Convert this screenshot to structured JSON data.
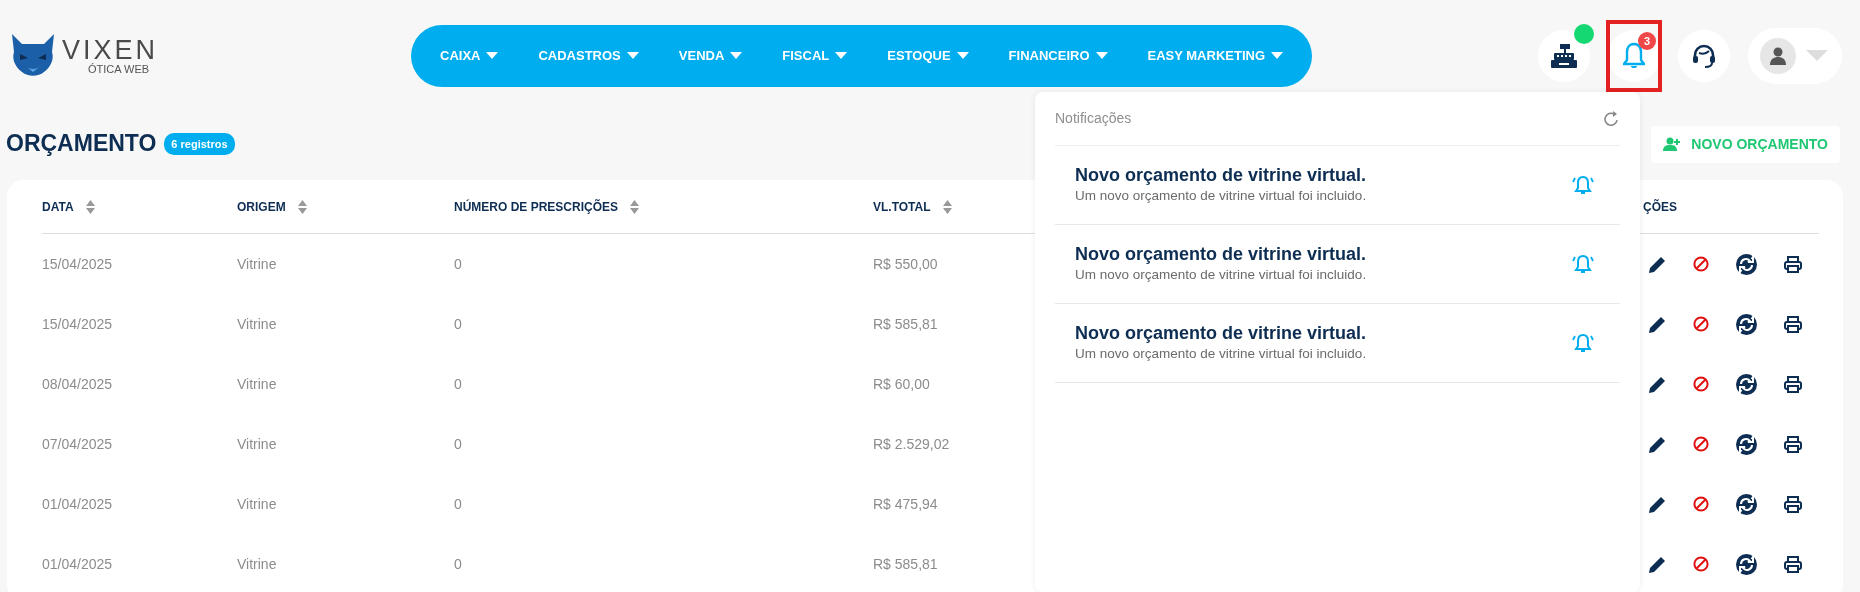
{
  "logo": {
    "name": "VIXEN",
    "tagline": "ÓTICA WEB"
  },
  "menu": [
    {
      "label": "CAIXA"
    },
    {
      "label": "CADASTROS"
    },
    {
      "label": "VENDA"
    },
    {
      "label": "FISCAL"
    },
    {
      "label": "ESTOQUE"
    },
    {
      "label": "FINANCEIRO"
    },
    {
      "label": "EASY MARKETING"
    }
  ],
  "cash_register": {
    "online": true
  },
  "notifications_button": {
    "badge": "3",
    "highlighted": true
  },
  "page": {
    "title": "ORÇAMENTO",
    "count": "6 registros",
    "new_button": "NOVO ORÇAMENTO"
  },
  "table": {
    "columns": [
      {
        "label": "DATA",
        "sortable": true
      },
      {
        "label": "ORIGEM",
        "sortable": true
      },
      {
        "label": "NÚMERO DE PRESCRIÇÕES",
        "sortable": true
      },
      {
        "label": "VL.TOTAL",
        "sortable": true
      },
      {
        "label": "ÇÕES",
        "sortable": false
      }
    ],
    "rows": [
      {
        "cells": [
          "15/04/2025",
          "Vitrine",
          "0",
          "R$ 550,00"
        ]
      },
      {
        "cells": [
          "15/04/2025",
          "Vitrine",
          "0",
          "R$ 585,81"
        ]
      },
      {
        "cells": [
          "08/04/2025",
          "Vitrine",
          "0",
          "R$ 60,00"
        ]
      },
      {
        "cells": [
          "07/04/2025",
          "Vitrine",
          "0",
          "R$ 2.529,02"
        ]
      },
      {
        "cells": [
          "01/04/2025",
          "Vitrine",
          "0",
          "R$ 475,94"
        ]
      },
      {
        "cells": [
          "01/04/2025",
          "Vitrine",
          "0",
          "R$ 585,81"
        ]
      }
    ]
  },
  "notifications": {
    "title": "Notificações",
    "items": [
      {
        "title": "Novo orçamento de vitrine virtual.",
        "message": "Um novo orçamento de vitrine virtual foi incluido."
      },
      {
        "title": "Novo orçamento de vitrine virtual.",
        "message": "Um novo orçamento de vitrine virtual foi incluido."
      },
      {
        "title": "Novo orçamento de vitrine virtual.",
        "message": "Um novo orçamento de vitrine virtual foi incluido."
      }
    ]
  }
}
